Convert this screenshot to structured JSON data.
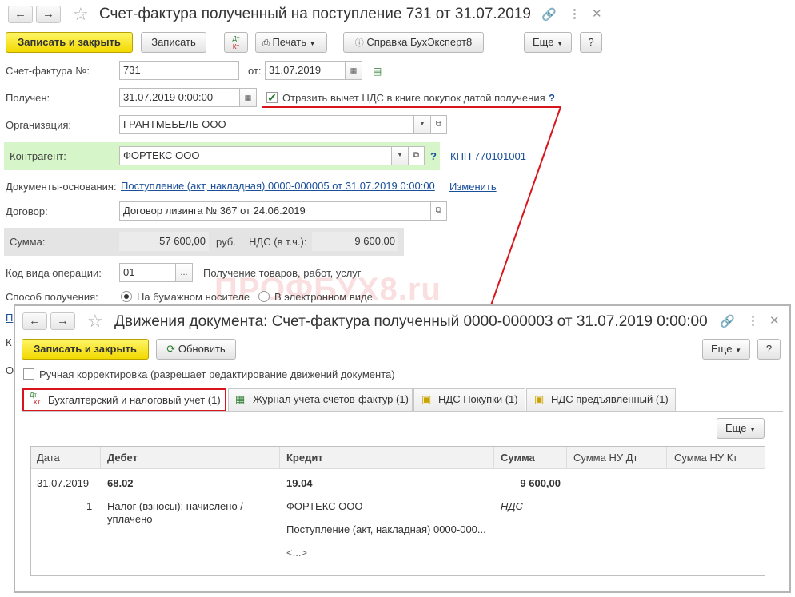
{
  "back_window": {
    "title": "Счет-фактура полученный на поступление 731 от 31.07.2019",
    "toolbar": {
      "save_close": "Записать и закрыть",
      "save": "Записать",
      "dtkt_top": "Дт",
      "dtkt_bottom": "Кт",
      "print": "Печать",
      "help": "Справка БухЭксперт8",
      "more": "Еще",
      "question": "?"
    },
    "fields": {
      "invoice_label": "Счет-фактура №:",
      "invoice_value": "731",
      "from_label": "от:",
      "from_value": "31.07.2019",
      "received_label": "Получен:",
      "received_value": "31.07.2019  0:00:00",
      "vat_checkbox_label": "Отразить вычет НДС в книге покупок датой получения",
      "org_label": "Организация:",
      "org_value": "ГРАНТМЕБЕЛЬ ООО",
      "counterparty_label": "Контрагент:",
      "counterparty_value": "ФОРТЕКС ООО",
      "kpp_link": "КПП 770101001",
      "docs_label": "Документы-основания:",
      "docs_link": "Поступление (акт, накладная) 0000-000005 от 31.07.2019 0:00:00",
      "change_link": "Изменить",
      "contract_label": "Договор:",
      "contract_value": "Договор лизинга № 367 от 24.06.2019",
      "sum_label": "Сумма:",
      "sum_value": "57 600,00",
      "currency": "руб.",
      "vat_label": "НДС (в т.ч.):",
      "vat_value": "9 600,00",
      "op_code_label": "Код вида операции:",
      "op_code_value": "01",
      "op_code_desc": "Получение товаров, работ, услуг",
      "method_label": "Способ получения:",
      "method_paper": "На бумажном носителе",
      "method_electronic": "В электронном виде",
      "cut_letter_1": "П",
      "cut_letter_2": "К",
      "cut_letter_3": "О"
    },
    "watermark": "ПРОФБУХ8.ru"
  },
  "front_window": {
    "title": "Движения документа: Счет-фактура полученный 0000-000003 от 31.07.2019 0:00:00",
    "toolbar": {
      "save_close": "Записать и закрыть",
      "refresh": "Обновить",
      "more": "Еще",
      "question": "?"
    },
    "manual_correction": "Ручная корректировка (разрешает редактирование движений документа)",
    "tabs": [
      {
        "label": "Бухгалтерский и налоговый учет (1)"
      },
      {
        "label": "Журнал учета счетов-фактур (1)"
      },
      {
        "label": "НДС Покупки (1)"
      },
      {
        "label": "НДС предъявленный (1)"
      }
    ],
    "table_more": "Еще",
    "columns": [
      "Дата",
      "Дебет",
      "Кредит",
      "Сумма",
      "Сумма НУ Дт",
      "Сумма НУ Кт"
    ],
    "row": {
      "date": "31.07.2019",
      "index": "1",
      "debit_account": "68.02",
      "debit_line1": "Налог (взносы): начислено /",
      "debit_line2": "уплачено",
      "credit_account": "19.04",
      "credit_sub1": "ФОРТЕКС ООО",
      "credit_sub2": "Поступление (акт, накладная) 0000-000...",
      "credit_sub3": "<...>",
      "sum": "9 600,00",
      "sum_note": "НДС"
    }
  },
  "colors": {
    "accent_yellow": "#f5e21a",
    "highlight_red": "#d9141b",
    "link_blue": "#1a4f9a",
    "counterparty_bg": "#d6f5c9",
    "sum_bg": "#e4e4e4"
  }
}
